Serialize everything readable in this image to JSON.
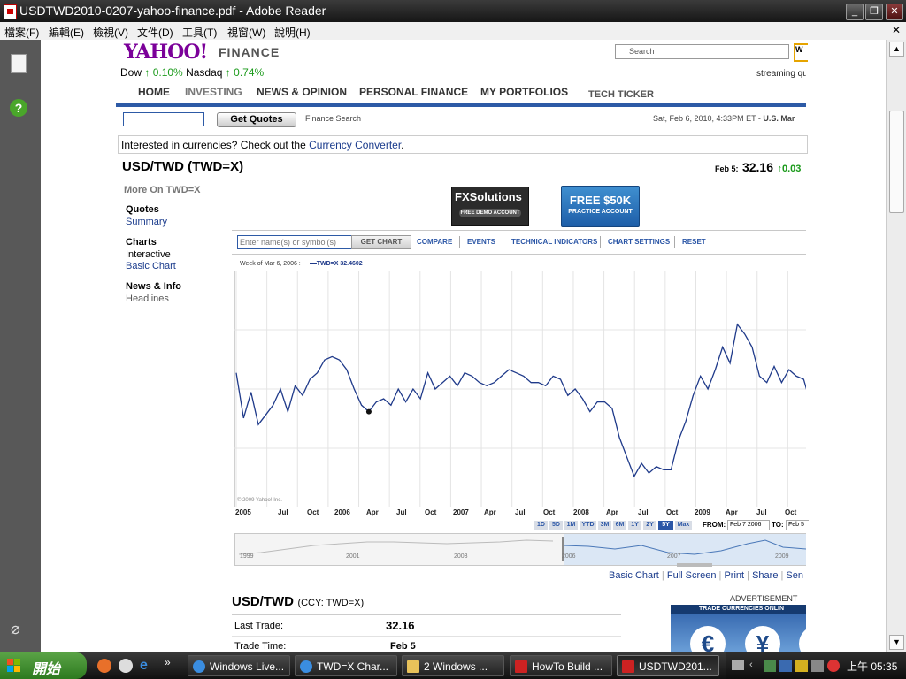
{
  "window": {
    "title": "USDTWD2010-0207-yahoo-finance.pdf - Adobe Reader"
  },
  "menu": [
    "檔案(F)",
    "編輯(E)",
    "檢視(V)",
    "文件(D)",
    "工具(T)",
    "視窗(W)",
    "說明(H)"
  ],
  "yahoo": {
    "logo": "YAHOO!",
    "logo_sub": "FINANCE",
    "search_placeholder": "Search",
    "dow_label": "Dow",
    "dow_change": "0.10%",
    "nasdaq_label": "Nasdaq",
    "nasdaq_change": "0.74%",
    "streaming": "streaming qu",
    "nav": [
      "HOME",
      "INVESTING",
      "NEWS & OPINION",
      "PERSONAL FINANCE",
      "MY PORTFOLIOS",
      "TECH TICKER"
    ],
    "get_quotes": "Get Quotes",
    "finance_search": "Finance Search",
    "datetime": "Sat, Feb 6, 2010, 4:33PM ET - ",
    "market": "U.S. Mar",
    "currency_msg": "Interested in currencies? Check out the ",
    "currency_link": "Currency Converter",
    "currency_end": "."
  },
  "quote": {
    "title": "USD/TWD (TWD=X)",
    "date_label": "Feb 5:",
    "price": "32.16",
    "change": "0.03"
  },
  "sidebar": {
    "more_on": "More On TWD=X",
    "quotes": "Quotes",
    "summary": "Summary",
    "charts": "Charts",
    "interactive": "Interactive",
    "basic_chart": "Basic Chart",
    "news_info": "News & Info",
    "headlines": "Headlines"
  },
  "ads": {
    "fx_title": "FXSolutions",
    "fx_sub": "FREE DEMO ACCOUNT",
    "free_title": "FREE $50K",
    "free_sub": "PRACTICE ACCOUNT"
  },
  "chart_toolbar": {
    "symbol_placeholder": "Enter name(s) or symbol(s)",
    "get_chart": "GET CHART",
    "compare": "COMPARE",
    "events": "EVENTS",
    "technical": "TECHNICAL INDICATORS",
    "settings": "CHART SETTINGS",
    "reset": "RESET"
  },
  "chart_info": {
    "week_label": "Week of Mar 6, 2006 :",
    "series_label": "TWD=X 32.4602",
    "copyright": "© 2009 Yahoo! Inc."
  },
  "chart_data": {
    "type": "line",
    "series": [
      {
        "name": "TWD=X",
        "color": "#1f3a8a"
      }
    ],
    "x_ticks": [
      "2005",
      "Jul",
      "Oct",
      "2006",
      "Apr",
      "Jul",
      "Oct",
      "2007",
      "Apr",
      "Jul",
      "Oct",
      "2008",
      "Apr",
      "Jul",
      "Oct",
      "2009",
      "Apr",
      "Jul",
      "Oct"
    ],
    "values": [
      33.5,
      32.1,
      32.9,
      31.9,
      32.2,
      32.5,
      33.0,
      32.3,
      33.1,
      32.8,
      33.3,
      33.5,
      33.9,
      34.0,
      33.9,
      33.6,
      33.0,
      32.5,
      32.3,
      32.6,
      32.7,
      32.5,
      33.0,
      32.6,
      33.0,
      32.7,
      33.5,
      33.0,
      33.2,
      33.4,
      33.1,
      33.5,
      33.4,
      33.2,
      33.1,
      33.2,
      33.4,
      33.6,
      33.5,
      33.4,
      33.2,
      33.2,
      33.1,
      33.4,
      33.3,
      32.8,
      33.0,
      32.7,
      32.3,
      32.6,
      32.6,
      32.4,
      31.5,
      30.9,
      30.3,
      30.7,
      30.4,
      30.6,
      30.5,
      30.5,
      31.4,
      32.0,
      32.8,
      33.4,
      33.0,
      33.6,
      34.3,
      33.8,
      35.0,
      34.7,
      34.3,
      33.4,
      33.2,
      33.7,
      33.2,
      33.6,
      33.4,
      33.3,
      32.5,
      32.7
    ],
    "ylim": [
      29.5,
      36.5
    ]
  },
  "ranges": {
    "buttons": [
      "1D",
      "5D",
      "1M",
      "YTD",
      "3M",
      "6M",
      "1Y",
      "2Y",
      "5Y",
      "Max"
    ],
    "selected": "5Y",
    "from_label": "FROM:",
    "from_value": "Feb 7 2006",
    "to_label": "TO:",
    "to_value": "Feb 5"
  },
  "overview": {
    "labels": [
      "1999",
      "2001",
      "2003",
      "2006",
      "2007",
      "2009"
    ]
  },
  "chart_links": [
    "Basic Chart",
    "Full Screen",
    "Print",
    "Share",
    "Sen"
  ],
  "summary": {
    "title": "USD/TWD",
    "subtitle": "(CCY: TWD=X)",
    "last_trade_label": "Last Trade:",
    "last_trade_value": "32.16",
    "trade_time_label": "Trade Time:",
    "trade_time_value": "Feb 5"
  },
  "advert": {
    "label": "ADVERTISEMENT",
    "banner": "TRADE CURRENCIES ONLIN",
    "symbols": [
      "€",
      "¥"
    ]
  },
  "taskbar": {
    "start": "開始",
    "tasks": [
      "Windows Live...",
      "TWD=X Char...",
      "2 Windows ...",
      "HowTo Build ...",
      "USDTWD201..."
    ],
    "clock": "上午 05:35"
  }
}
